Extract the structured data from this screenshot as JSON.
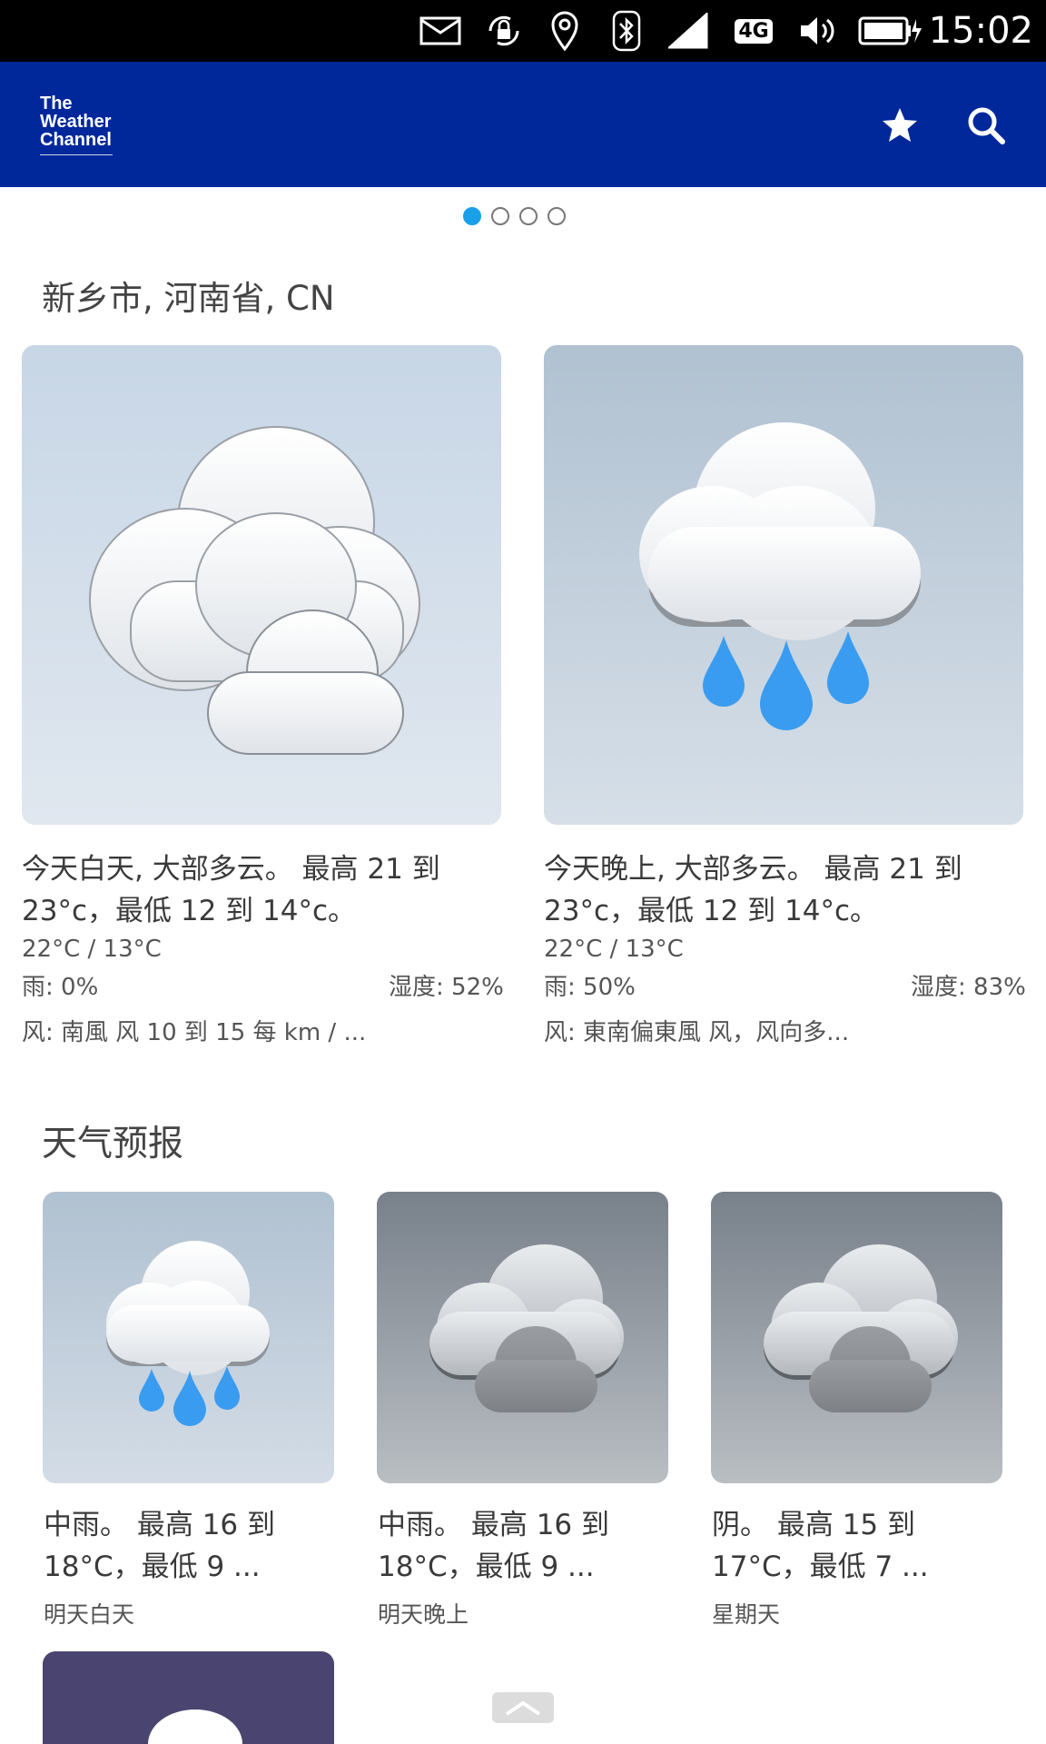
{
  "status_bar": {
    "time": "15:02",
    "network": "4G",
    "icons": [
      "mail-icon",
      "rotation-lock-icon",
      "location-pin-icon",
      "bluetooth-icon",
      "cell-signal-icon",
      "4g-icon",
      "volume-icon",
      "battery-charging-icon"
    ]
  },
  "app_bar": {
    "logo_line1": "The",
    "logo_line2": "Weather",
    "logo_line3": "Channel",
    "icons": [
      "star-icon",
      "search-icon"
    ],
    "color": "#00289a"
  },
  "pager": {
    "count": 4,
    "active": 1,
    "accent": "#1aa0e8"
  },
  "location": {
    "title": "新乡市, 河南省, CN"
  },
  "today": [
    {
      "icon": "partly-cloudy-icon",
      "line1": "今天白天, 大部多云。 最高 21 到",
      "line2": "23°c，最低 12 到 14°c。",
      "temps": "22°C / 13°C",
      "rain": "雨: 0%",
      "humidity": "湿度: 52%",
      "wind": "风: 南風 风 10 到 15 每 km / ..."
    },
    {
      "icon": "rain-cloud-icon",
      "line1": "今天晚上, 大部多云。 最高 21 到",
      "line2": "23°c，最低 12 到 14°c。",
      "temps": "22°C / 13°C",
      "rain": "雨: 50%",
      "humidity": "湿度: 83%",
      "wind": "风: 東南偏東風 风，风向多..."
    }
  ],
  "forecast": {
    "title": "天气预报",
    "items": [
      {
        "icon": "rain-cloud-icon",
        "line1": "中雨。 最高 16 到",
        "line2": "18°C，最低 9 ...",
        "when": "明天白天"
      },
      {
        "icon": "overcast-icon",
        "line1": "中雨。 最高 16 到",
        "line2": "18°C，最低 9 ...",
        "when": "明天晚上"
      },
      {
        "icon": "overcast-icon",
        "line1": "阴。 最高 15 到",
        "line2": "17°C，最低 7 ...",
        "when": "星期天"
      }
    ]
  },
  "colors": {
    "rain_drop": "#3a9cf0",
    "night_card": "#4a4470"
  }
}
